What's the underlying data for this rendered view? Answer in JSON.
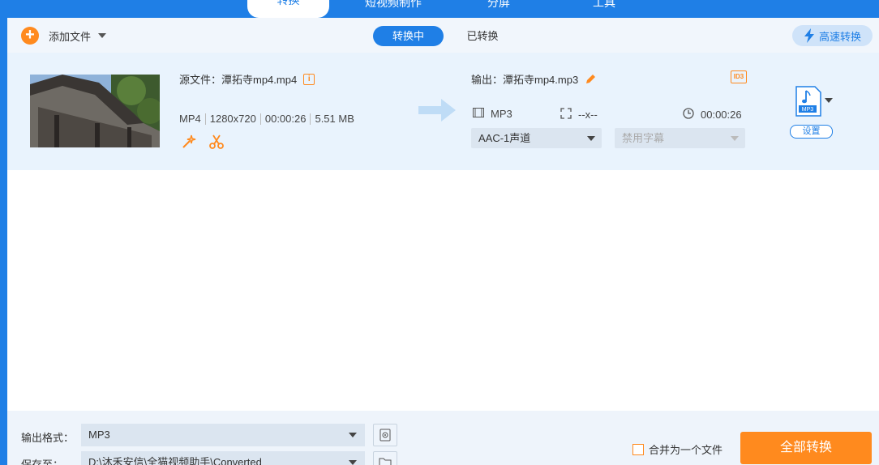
{
  "tabs": [
    "转换",
    "短视频制作",
    "分屏",
    "工具"
  ],
  "toolbar": {
    "add_file_label": "添加文件",
    "seg_converting": "转换中",
    "seg_converted": "已转换",
    "fast_convert_label": "高速转换"
  },
  "file": {
    "source_label": "源文件：潭拓寺mp4.mp4",
    "src_format": "MP4",
    "src_resolution": "1280x720",
    "src_duration": "00:00:26",
    "src_size": "5.51 MB",
    "output_label": "输出：潭拓寺mp4.mp3",
    "id3_label": "ID3",
    "out_format": "MP3",
    "out_resolution": "--x--",
    "out_duration": "00:00:26",
    "audio_track": "AAC-1声道",
    "subtitle": "禁用字幕",
    "format_icon_text": "MP3",
    "settings_label": "设置"
  },
  "bottom": {
    "output_format_label": "输出格式：",
    "output_format_value": "MP3",
    "save_to_label": "保存至：",
    "save_to_value": "D:\\沐禾安信\\全猫视频助手\\Converted",
    "merge_label": "合并为一个文件",
    "convert_all_label": "全部转换"
  },
  "colors": {
    "brand_blue": "#1f7fe6",
    "accent_orange": "#ff8a1e"
  }
}
